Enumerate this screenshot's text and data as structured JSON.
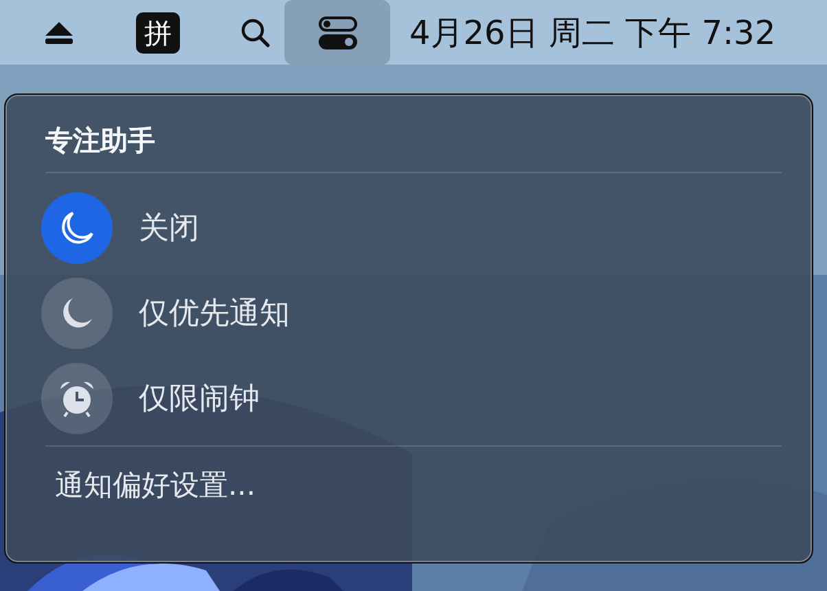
{
  "menu_bar": {
    "input_method": "拼",
    "control_center_selected": true,
    "clock": "4月26日 周二 下午 7:32"
  },
  "panel": {
    "title": "专注助手",
    "modes": [
      {
        "label": "关闭",
        "kind": "moon",
        "selected": true
      },
      {
        "label": "仅优先通知",
        "kind": "moon",
        "selected": false
      },
      {
        "label": "仅限闹钟",
        "kind": "alarm",
        "selected": false
      }
    ],
    "footer_link": "通知偏好设置..."
  }
}
